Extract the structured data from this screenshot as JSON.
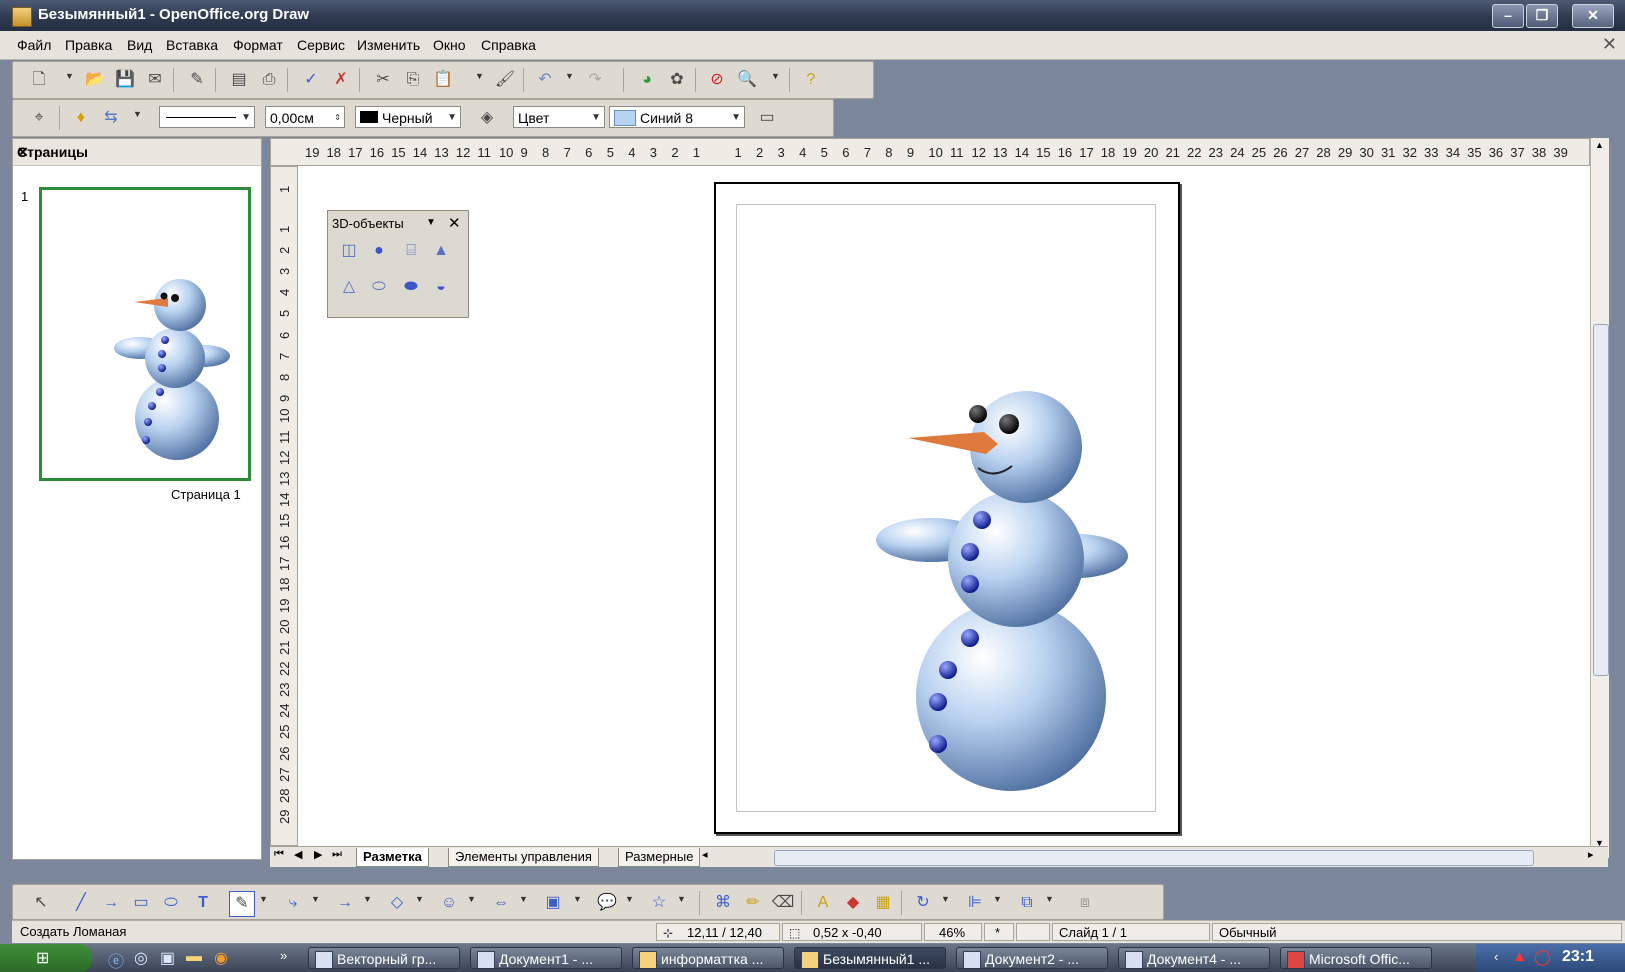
{
  "window": {
    "title": "Безымянный1 - OpenOffice.org Draw"
  },
  "menu": [
    "Файл",
    "Правка",
    "Вид",
    "Вставка",
    "Формат",
    "Сервис",
    "Изменить",
    "Окно",
    "Справка"
  ],
  "line_toolbar": {
    "line_width": "0,00см",
    "line_color": "Черный",
    "fill_type": "Цвет",
    "fill_color": "Синий 8"
  },
  "pages_panel": {
    "title": "Страницы",
    "page_number": "1",
    "page_label": "Страница 1"
  },
  "hruler_labels": [
    "19",
    "18",
    "17",
    "16",
    "15",
    "14",
    "13",
    "12",
    "11",
    "10",
    "9",
    "8",
    "7",
    "6",
    "5",
    "4",
    "3",
    "2",
    "1",
    "1",
    "2",
    "3",
    "4",
    "5",
    "6",
    "7",
    "8",
    "9",
    "10",
    "11",
    "12",
    "13",
    "14",
    "15",
    "16",
    "17",
    "18",
    "19",
    "20",
    "21",
    "22",
    "23",
    "24",
    "25",
    "26",
    "27",
    "28",
    "29",
    "30",
    "31",
    "32",
    "33",
    "34",
    "35",
    "36",
    "37",
    "38",
    "39"
  ],
  "vruler_labels": [
    "1",
    "1",
    "2",
    "3",
    "4",
    "5",
    "6",
    "7",
    "8",
    "9",
    "10",
    "11",
    "12",
    "13",
    "14",
    "15",
    "16",
    "17",
    "18",
    "19",
    "20",
    "21",
    "22",
    "23",
    "24",
    "25",
    "26",
    "27",
    "28",
    "29"
  ],
  "panel3d": {
    "title": "3D-объекты"
  },
  "tabs": [
    "Разметка",
    "Элементы управления",
    "Размерные"
  ],
  "status": {
    "action": "Создать Ломаная",
    "position": "12,11 / 12,40",
    "size": "0,52 x -0,40",
    "zoom": "46%",
    "modified": "*",
    "slide": "Слайд 1 / 1",
    "style": "Обычный"
  },
  "taskbar": {
    "tasks": [
      "Векторный гр...",
      "Документ1 - ...",
      "информаттка ...",
      "Безымянный1 ...",
      "Документ2 - ...",
      "Документ4 - ...",
      "Microsoft Offic..."
    ],
    "clock": "23:1"
  },
  "colors": {
    "accent": "#6f9bd6",
    "snow": "#b8d0f0",
    "button": "#2a3bb8",
    "nose": "#e07a3c",
    "selection": "#2e8b3a"
  }
}
